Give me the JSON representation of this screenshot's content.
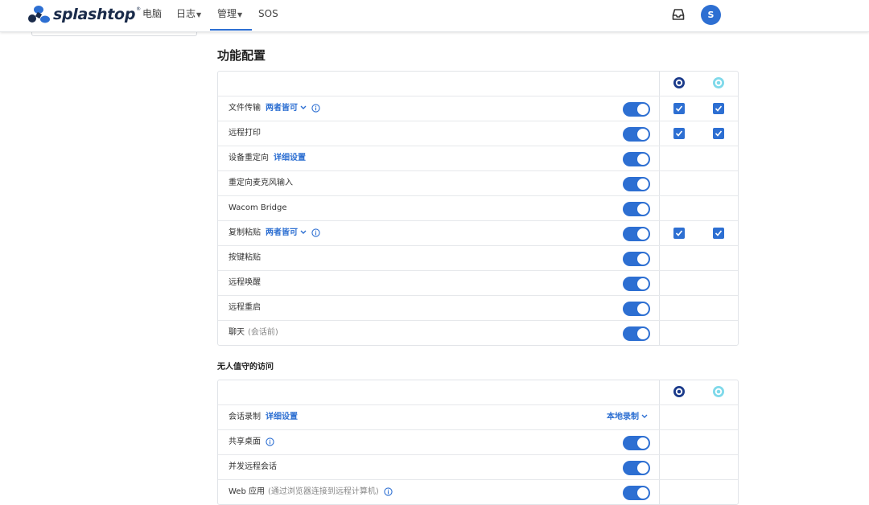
{
  "brand": {
    "name": "splashtop",
    "reg": "®",
    "colors": {
      "primary": "#2d6fd2",
      "dark": "#1a2b4a",
      "cyan": "#7fd9ea"
    }
  },
  "nav": {
    "items": [
      {
        "label": "电脑",
        "dropdown": false,
        "active": false
      },
      {
        "label": "日志",
        "dropdown": true,
        "active": false
      },
      {
        "label": "管理",
        "dropdown": true,
        "active": true
      },
      {
        "label": "SOS",
        "dropdown": false,
        "active": false
      }
    ],
    "inbox_icon": "inbox-icon",
    "avatar_initial": "S"
  },
  "features": {
    "title": "功能配置",
    "header_icons": [
      "business-app-icon",
      "sos-app-icon"
    ],
    "rows": [
      {
        "label": "文件传输",
        "link": "两者皆可",
        "dropdown": true,
        "info": true,
        "toggle": true,
        "cb1": true,
        "cb2": true
      },
      {
        "label": "远程打印",
        "toggle": true,
        "cb1": true,
        "cb2": true
      },
      {
        "label": "设备重定向",
        "link": "详细设置",
        "toggle": true
      },
      {
        "label": "重定向麦克风输入",
        "toggle": true
      },
      {
        "label": "Wacom Bridge",
        "toggle": true
      },
      {
        "label": "复制粘贴",
        "link": "两者皆可",
        "dropdown": true,
        "info": true,
        "toggle": true,
        "cb1": true,
        "cb2": true
      },
      {
        "label": "按键粘贴",
        "toggle": true
      },
      {
        "label": "远程唤醒",
        "toggle": true
      },
      {
        "label": "远程重启",
        "toggle": true
      },
      {
        "label": "聊天",
        "muted": "(会话前)",
        "toggle": true
      }
    ]
  },
  "unattended": {
    "title": "无人值守的访问",
    "header_icons": [
      "business-app-icon",
      "sos-app-icon"
    ],
    "rows": [
      {
        "label": "会话录制",
        "link": "详细设置",
        "right_link": "本地录制",
        "right_dropdown": true
      },
      {
        "label": "共享桌面",
        "info": true,
        "toggle": true
      },
      {
        "label": "并发远程会话",
        "toggle": true
      },
      {
        "label": "Web 应用",
        "muted": "(通过浏览器连接到远程计算机)",
        "info": true,
        "toggle": true
      }
    ]
  }
}
